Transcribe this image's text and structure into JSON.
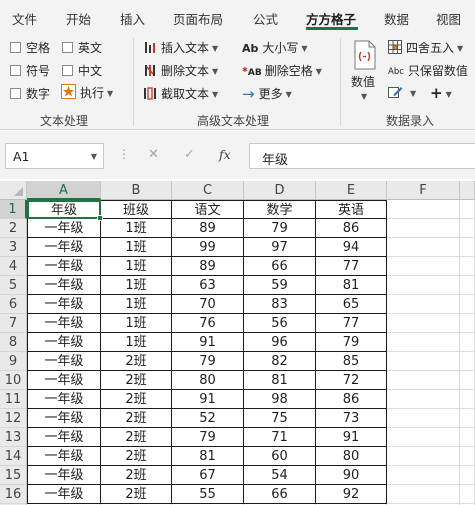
{
  "tabs": [
    {
      "label": "文件",
      "active": false
    },
    {
      "label": "开始",
      "active": false
    },
    {
      "label": "插入",
      "active": false
    },
    {
      "label": "页面布局",
      "active": false
    },
    {
      "label": "公式",
      "active": false
    },
    {
      "label": "方方格子",
      "active": true
    },
    {
      "label": "数据",
      "active": false
    },
    {
      "label": "视图",
      "active": false
    }
  ],
  "ribbon": {
    "text_processing": {
      "checkboxes": [
        "空格",
        "英文",
        "符号",
        "中文",
        "数字"
      ],
      "execute_label": "执行",
      "group_label": "文本处理"
    },
    "advanced_text": {
      "insert_text": "插入文本",
      "delete_text": "删除文本",
      "extract_text": "截取文本",
      "case_label": "大小写",
      "case_icon_text": "Ab",
      "delete_space": "删除空格",
      "delete_space_icon_text": "AB",
      "more": "更多",
      "group_label": "高级文本处理"
    },
    "number_entry": {
      "value_label": "数值",
      "round_label": "四舍五入",
      "keep_value_label": "只保留数值",
      "keep_value_icon_text": "Abc",
      "group_label": "数据录入"
    }
  },
  "formula_bar": {
    "name_box": "A1",
    "formula": "年级",
    "fx_label": "fx",
    "cancel_symbol": "✕",
    "enter_symbol": "✓",
    "separator": "⋮"
  },
  "grid": {
    "columns": [
      "A",
      "B",
      "C",
      "D",
      "E",
      "F"
    ],
    "rows": [
      [
        "年级",
        "班级",
        "语文",
        "数学",
        "英语"
      ],
      [
        "一年级",
        "1班",
        "89",
        "79",
        "86"
      ],
      [
        "一年级",
        "1班",
        "99",
        "97",
        "94"
      ],
      [
        "一年级",
        "1班",
        "89",
        "66",
        "77"
      ],
      [
        "一年级",
        "1班",
        "63",
        "59",
        "81"
      ],
      [
        "一年级",
        "1班",
        "70",
        "83",
        "65"
      ],
      [
        "一年级",
        "1班",
        "76",
        "56",
        "77"
      ],
      [
        "一年级",
        "1班",
        "91",
        "96",
        "79"
      ],
      [
        "一年级",
        "2班",
        "79",
        "82",
        "85"
      ],
      [
        "一年级",
        "2班",
        "80",
        "81",
        "72"
      ],
      [
        "一年级",
        "2班",
        "91",
        "98",
        "86"
      ],
      [
        "一年级",
        "2班",
        "52",
        "75",
        "73"
      ],
      [
        "一年级",
        "2班",
        "79",
        "71",
        "91"
      ],
      [
        "一年级",
        "2班",
        "81",
        "60",
        "80"
      ],
      [
        "一年级",
        "2班",
        "67",
        "54",
        "90"
      ],
      [
        "一年级",
        "2班",
        "55",
        "66",
        "92"
      ]
    ],
    "active_cell": "A1"
  },
  "colors": {
    "accent_green": "#217346",
    "ribbon_bg": "#f3f3f3",
    "header_bg": "#e9e9e9",
    "icon_red": "#c0392b",
    "icon_blue": "#2e75b6"
  }
}
